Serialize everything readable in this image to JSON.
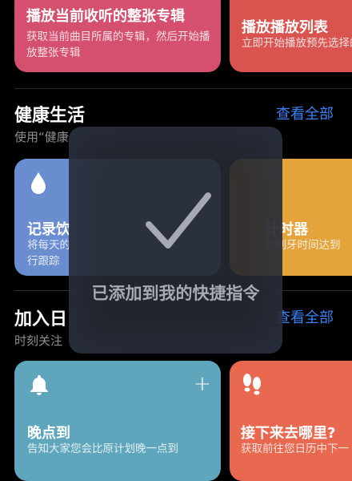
{
  "top_cards": [
    {
      "title": "播放当前收听的整张专辑",
      "desc": "获取当前曲目所属的专辑，然后开始播放整张专辑"
    },
    {
      "title": "播放播放列表",
      "desc": "立即开始播放预先选择的"
    }
  ],
  "health_section": {
    "title": "健康生活",
    "subtitle": "使用“健康",
    "see_all": "查看全部",
    "cards": [
      {
        "title": "记录饮",
        "desc": "将每天的行跟踪",
        "icon": "water-drop-icon"
      },
      {
        "title": "计时器",
        "desc": "为刷牙时间达到",
        "icon": "timer-icon"
      }
    ]
  },
  "join_section": {
    "title": "加入日",
    "subtitle": "时刻关注",
    "see_all": "查看全部",
    "cards": [
      {
        "title": "晚点到",
        "desc": "告知大家您会比原计划晚一点到",
        "icon": "bell-icon",
        "plus": "+"
      },
      {
        "title": "接下来去哪里?",
        "desc": "获取前往您日历中下一",
        "icon": "footprints-icon"
      }
    ]
  },
  "hud": {
    "message": "已添加到我的快捷指令"
  },
  "colors": {
    "card_pink": "#d5506e",
    "card_red": "#d9534f",
    "card_blue": "#6a8dd0",
    "card_yellow": "#e5a43b",
    "card_teal": "#5fa6bd",
    "card_orange": "#e8694f",
    "link_blue": "#3b82f6"
  }
}
